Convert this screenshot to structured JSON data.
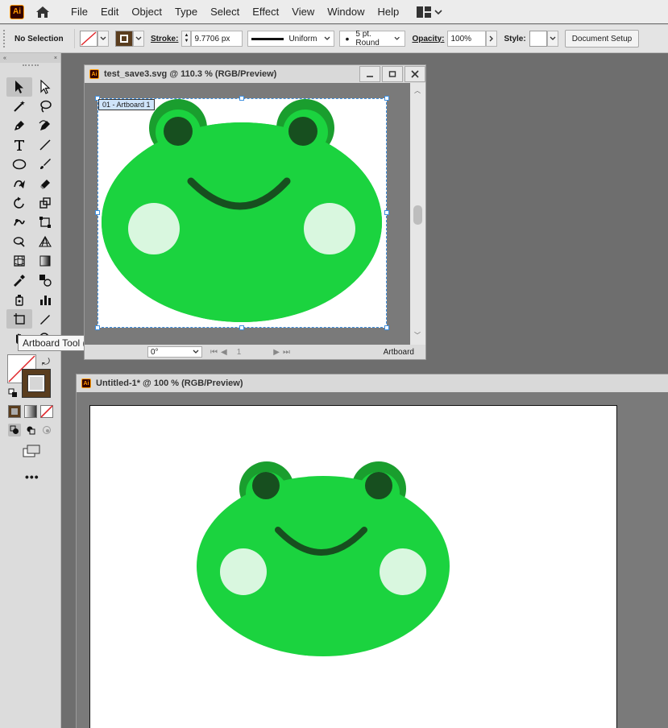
{
  "app": {
    "logo_text": "Ai"
  },
  "menu": [
    "File",
    "Edit",
    "Object",
    "Type",
    "Select",
    "Effect",
    "View",
    "Window",
    "Help"
  ],
  "control_bar": {
    "selection": "No Selection",
    "stroke_label": "Stroke:",
    "stroke_value": "9.7706 px",
    "profile": "Uniform",
    "brush": "5 pt. Round",
    "opacity_label": "Opacity:",
    "opacity_value": "100%",
    "style_label": "Style:",
    "doc_setup": "Document Setup"
  },
  "tooltip": "Artboard Tool (Shift+O)",
  "doc1": {
    "title": "test_save3.svg @ 110.3 % (RGB/Preview)",
    "artboard_label": "01 - Artboard 1",
    "rotation": "0°",
    "page": "1",
    "status": "Artboard"
  },
  "doc2": {
    "title": "Untitled-1* @ 100 % (RGB/Preview)"
  },
  "colors": {
    "frog_green": "#1bd33f",
    "eye_ring": "#1a9e2e",
    "pupil": "#174f1f",
    "cheek": "#d9f7df",
    "smile": "#174f1f",
    "selection_blue": "#3d8fe0"
  }
}
